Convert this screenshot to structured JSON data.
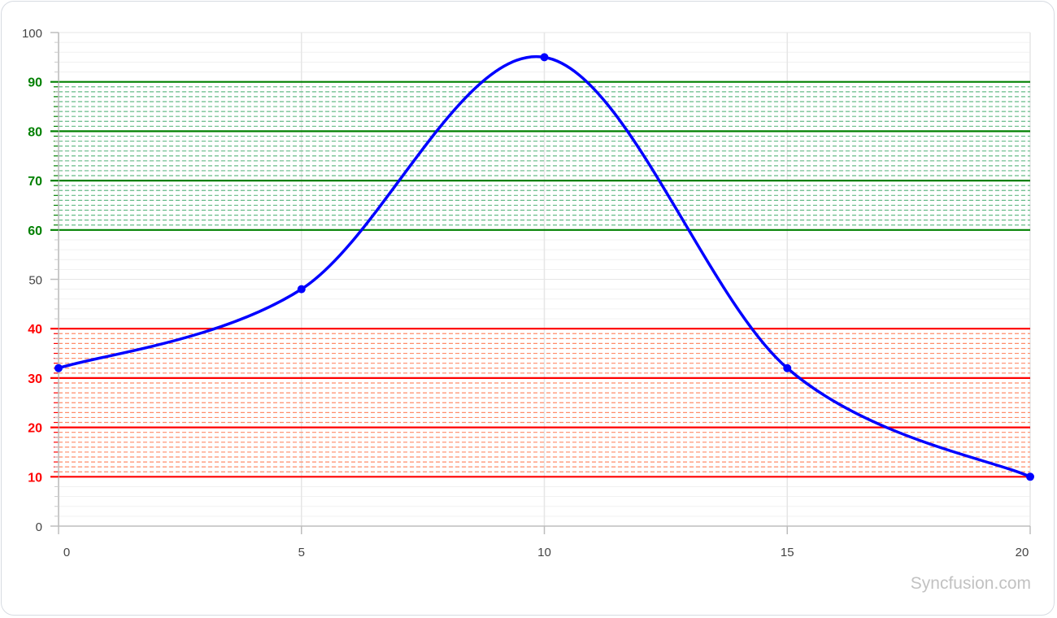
{
  "chart_data": {
    "type": "line",
    "style": "spline",
    "title": "",
    "xlabel": "",
    "ylabel": "",
    "xlim": [
      0,
      20
    ],
    "ylim": [
      0,
      100
    ],
    "x_ticks": [
      0,
      5,
      10,
      15,
      20
    ],
    "y_ticks": [
      0,
      10,
      20,
      30,
      40,
      50,
      60,
      70,
      80,
      90,
      100
    ],
    "grid": true,
    "series": [
      {
        "color": "#0000ff",
        "x": [
          0,
          5,
          10,
          15,
          20
        ],
        "y": [
          32,
          48,
          95,
          32,
          10
        ]
      }
    ],
    "bands": [
      {
        "from": 60,
        "to": 90,
        "line_color": "#008000",
        "dash_color": "#66bb88",
        "highlighted_ticks": [
          60,
          70,
          80,
          90
        ]
      },
      {
        "from": 10,
        "to": 40,
        "line_color": "#ff0000",
        "dash_color": "#ff8c69",
        "highlighted_ticks": [
          10,
          20,
          30,
          40
        ]
      }
    ]
  },
  "watermark": "Syncfusion.com"
}
